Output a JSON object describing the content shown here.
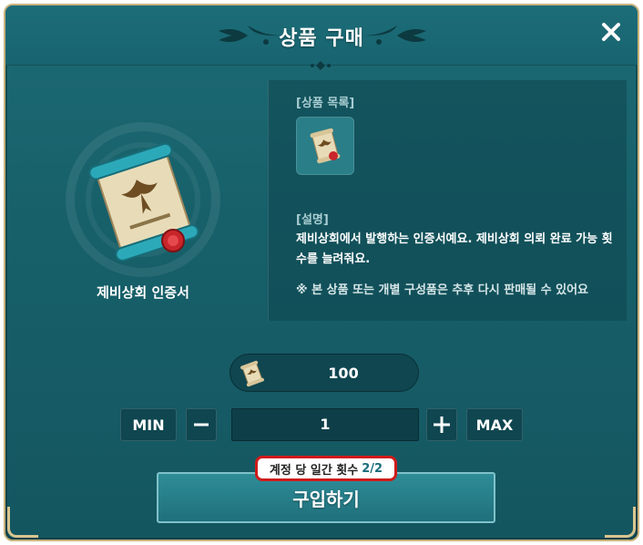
{
  "dialog": {
    "title": "상품 구매",
    "close_icon": "close-icon"
  },
  "item": {
    "name": "제비상회 인증서",
    "icon": "certificate-scroll-icon"
  },
  "details": {
    "product_list_label": "[상품 목록]",
    "description_label": "[설명]",
    "description": "제비상회에서 발행하는 인증서예요. 제비상회 의뢰 완료 가능 횟수를 늘려줘요.",
    "note": "※ 본 상품 또는 개별 구성품은 추후 다시 판매될 수 있어요"
  },
  "price": {
    "value": "100",
    "currency_icon": "certificate-scroll-icon"
  },
  "quantity": {
    "min_label": "MIN",
    "minus_label": "−",
    "value": "1",
    "plus_label": "+",
    "max_label": "MAX"
  },
  "purchase": {
    "limit_label": "계정 당 일간 횟수",
    "limit_count": "2/2",
    "button_label": "구입하기"
  },
  "colors": {
    "panel": "#17606a",
    "accent_border": "#c9b27a",
    "highlight_red": "#d01a1a"
  }
}
